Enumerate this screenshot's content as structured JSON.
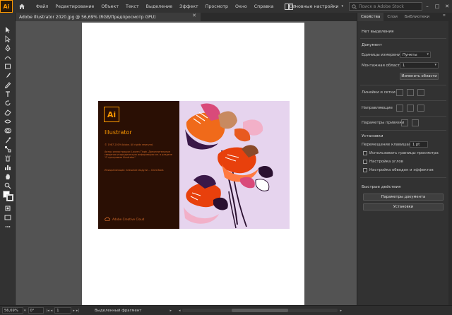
{
  "app": {
    "logo_text": "Ai",
    "name": "Adobe Illustrator"
  },
  "menubar": {
    "items": [
      "Файл",
      "Редактирование",
      "Объект",
      "Текст",
      "Выделение",
      "Эффект",
      "Просмотр",
      "Окно",
      "Справка"
    ],
    "workspace_label": "Основные настройки",
    "stock_search_placeholder": "Поиск в Adobe Stock"
  },
  "document": {
    "tab_title": "Adobe Illustrator 2020.jpg @ 56,69% (RGB/Предпросмотр GPU)"
  },
  "splash": {
    "logo": "Ai",
    "title": "Illustrator",
    "copyright": "© 1987-2019 Adobe. All rights reserved.",
    "artist_credit": "Автор иллюстрации: Lauren Tingh. Дополнительные сведения и юридическую информацию см. в разделе \"О программе Illustrator\"",
    "loading_text": "Инициализация: внешние модули ... DrawTools",
    "cloud_label": "Adobe Creative Cloud"
  },
  "panel": {
    "tabs": [
      "Свойства",
      "Слои",
      "Библиотеки"
    ],
    "active_tab": 0,
    "no_selection": "Нет выделения",
    "document_section": "Документ",
    "units_label": "Единицы измерения:",
    "units_value": "Пункты",
    "artboard_label": "Монтажная область:",
    "artboard_value": "1",
    "edit_artboards_button": "Изменить области",
    "rulers_grids": "Линейки и сетки",
    "guides": "Направляющие",
    "snap_options": "Параметры привязки",
    "preferences_section": "Установки",
    "keyboard_increment_label": "Перемещение клавишами:",
    "keyboard_increment_value": "1 pt",
    "checkboxes": [
      "Использовать границы просмотра",
      "Настройка углов",
      "Настройка обводок и эффектов"
    ],
    "quick_actions": "Быстрые действия",
    "doc_setup_button": "Параметры документа",
    "preferences_button": "Установки"
  },
  "statusbar": {
    "zoom": "56,69%",
    "rotation": "0°",
    "artboard_num": "1",
    "selection_text": "Выделенный фрагмент"
  },
  "colors": {
    "accent": "#ff9a00",
    "splash_dark": "#2a0f04",
    "splash_bg": "#e6d4ee",
    "canvas": "#535353"
  }
}
